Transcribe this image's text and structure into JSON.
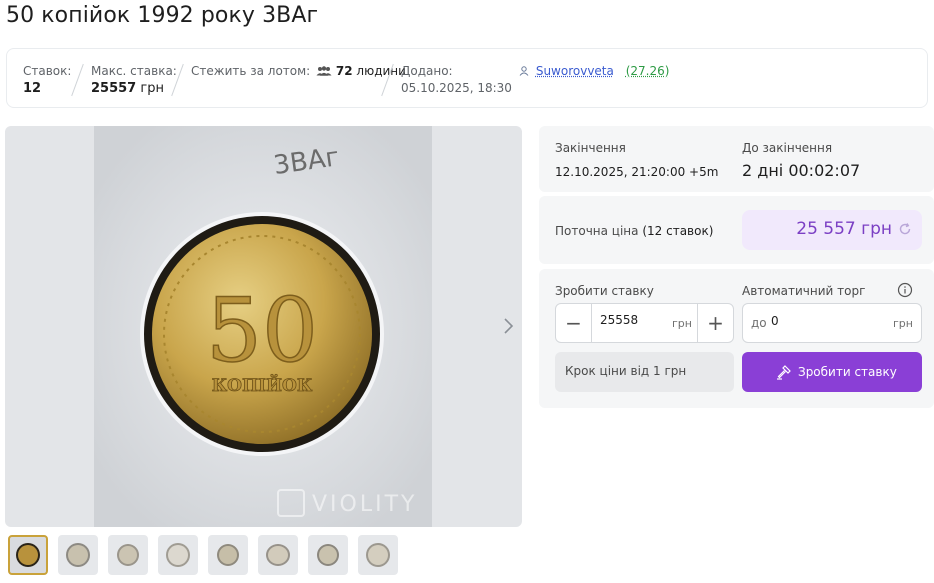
{
  "lot": {
    "title": "50 копійок 1992 року 3ВАг"
  },
  "infobar": {
    "bids_label": "Ставок:",
    "bids_value": "12",
    "maxbid_label": "Макс. ставка:",
    "maxbid_value": "25557",
    "maxbid_unit": "грн",
    "watch_label": "Стежить за лотом:",
    "watch_count": "72",
    "watch_unit": "людини",
    "added_label": "Додано:",
    "added_value": "05.10.2025, 18:30",
    "seller_name": "Suworovveta",
    "seller_rating": "(27.26)"
  },
  "gallery": {
    "photo_caption": "3ВАг",
    "coin_value": "50",
    "coin_text": "КОПІЙОК",
    "watermark": "VIOLITY",
    "thumbnail_count": 8
  },
  "auction": {
    "end_label": "Закінчення",
    "end_value": "12.10.2025, 21:20:00 +5m",
    "remaining_label": "До закінчення",
    "remaining_value": "2 дні 00:02:07",
    "current_price_label": "Поточна ціна",
    "current_price_bids": "(12 ставок)",
    "current_price_value": "25 557 грн",
    "make_bid_label": "Зробити ставку",
    "bid_input_value": "25558",
    "bid_unit": "грн",
    "auto_label": "Автоматичний торг",
    "auto_prefix": "до",
    "auto_value": "0",
    "auto_unit": "грн",
    "step_hint": "Крок ціни від 1 грн",
    "bid_button": "Зробити ставку"
  },
  "colors": {
    "accent": "#8a3fd6",
    "price_bg": "#f1e9fc",
    "price_text": "#7b3fc4",
    "seller_link": "#3a5bd0",
    "rating": "#2e9b45",
    "coin_gold": "#c9a23a"
  },
  "icons": {
    "watchers": "people-icon",
    "seller": "user-icon",
    "refresh": "refresh-icon",
    "info": "info-icon",
    "bid": "hammer-icon",
    "next": "chevron-right-icon"
  }
}
